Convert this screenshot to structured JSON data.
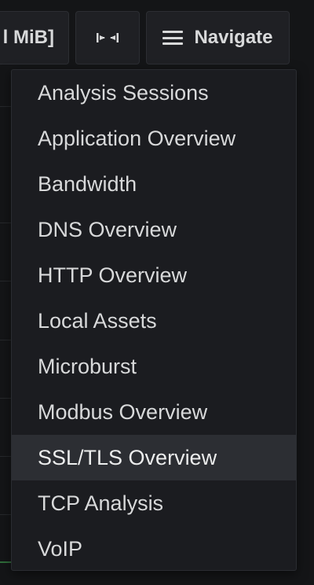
{
  "toolbar": {
    "range_label": "l MiB]",
    "zoom_icon": "zoom-out-icon",
    "navigate_label": "Navigate",
    "navigate_icon": "hamburger-icon"
  },
  "menu": {
    "active_index": 8,
    "items": [
      {
        "label": "Analysis Sessions"
      },
      {
        "label": "Application Overview"
      },
      {
        "label": "Bandwidth"
      },
      {
        "label": "DNS Overview"
      },
      {
        "label": "HTTP Overview"
      },
      {
        "label": "Local Assets"
      },
      {
        "label": "Microburst"
      },
      {
        "label": "Modbus Overview"
      },
      {
        "label": "SSL/TLS Overview"
      },
      {
        "label": "TCP Analysis"
      },
      {
        "label": "VoIP"
      }
    ]
  },
  "colors": {
    "background": "#141517",
    "menu_bg": "#1b1c20",
    "menu_active_bg": "#2c2e33",
    "text": "#d8d9da"
  }
}
